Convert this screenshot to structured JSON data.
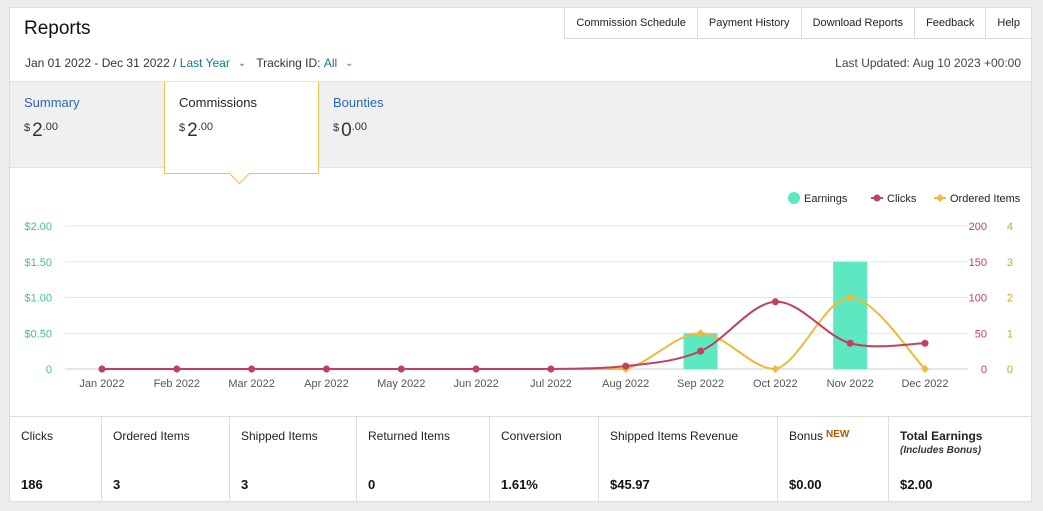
{
  "header": {
    "title": "Reports",
    "links": [
      "Commission Schedule",
      "Payment History",
      "Download Reports",
      "Feedback",
      "Help"
    ]
  },
  "filters": {
    "date_range": "Jan 01 2022 - Dec 31 2022 /",
    "period_label": "Last Year",
    "tracking_label": "Tracking ID:",
    "tracking_value": "All",
    "last_updated": "Last Updated: Aug 10 2023 +00:00"
  },
  "tabs": [
    {
      "label": "Summary",
      "currency": "$",
      "whole": "2",
      "cents": ".00",
      "active": false
    },
    {
      "label": "Commissions",
      "currency": "$",
      "whole": "2",
      "cents": ".00",
      "active": true
    },
    {
      "label": "Bounties",
      "currency": "$",
      "whole": "0",
      "cents": ".00",
      "active": false
    }
  ],
  "chart_data": {
    "type": "bar+line",
    "categories": [
      "Jan 2022",
      "Feb 2022",
      "Mar 2022",
      "Apr 2022",
      "May 2022",
      "Jun 2022",
      "Jul 2022",
      "Aug 2022",
      "Sep 2022",
      "Oct 2022",
      "Nov 2022",
      "Dec 2022"
    ],
    "legend": [
      "Earnings",
      "Clicks",
      "Ordered Items"
    ],
    "legend_placement": "top-right",
    "series": [
      {
        "name": "Earnings",
        "kind": "bar",
        "axis": "left",
        "color": "#5ee8c1",
        "values": [
          0,
          0,
          0,
          0,
          0,
          0,
          0,
          0,
          0.5,
          0,
          1.5,
          0
        ]
      },
      {
        "name": "Clicks",
        "kind": "line",
        "axis": "right-1",
        "color": "#c0405d",
        "values": [
          0,
          0,
          0,
          0,
          0,
          0,
          0,
          4,
          25,
          94,
          36,
          36
        ]
      },
      {
        "name": "Ordered Items",
        "kind": "line",
        "axis": "right-2",
        "color": "#f0b93a",
        "values": [
          0,
          0,
          0,
          0,
          0,
          0,
          0,
          0,
          1,
          0,
          2,
          0
        ]
      }
    ],
    "y_left": {
      "range": [
        0,
        2
      ],
      "ticks": [
        "0",
        "$0.50",
        "$1.00",
        "$1.50",
        "$2.00"
      ],
      "color": "#3fbf9f"
    },
    "y_right_1": {
      "range": [
        0,
        200
      ],
      "ticks": [
        "0",
        "50",
        "100",
        "150",
        "200"
      ],
      "color": "#c0405d"
    },
    "y_right_2": {
      "range": [
        0,
        4
      ],
      "ticks": [
        "0",
        "1",
        "2",
        "3",
        "4"
      ],
      "color": "#d9a521"
    },
    "grid": true
  },
  "stats": [
    {
      "label": "Clicks",
      "value": "186"
    },
    {
      "label": "Ordered Items",
      "value": "3"
    },
    {
      "label": "Shipped Items",
      "value": "3"
    },
    {
      "label": "Returned Items",
      "value": "0"
    },
    {
      "label": "Conversion",
      "value": "1.61%"
    },
    {
      "label": "Shipped Items Revenue",
      "value": "$45.97"
    },
    {
      "label": "Bonus",
      "badge": "NEW",
      "value": "$0.00"
    },
    {
      "label": "Total Earnings",
      "sub": "(Includes Bonus)",
      "value": "$2.00"
    }
  ]
}
